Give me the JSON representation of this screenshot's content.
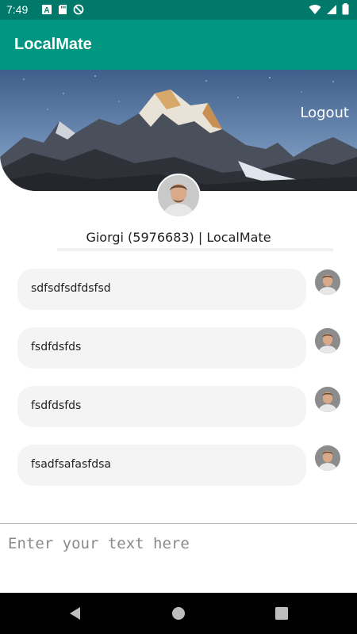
{
  "status_bar": {
    "time": "7:49",
    "left_icons": [
      "a-box-icon",
      "sd-card-icon",
      "no-sync-icon"
    ],
    "right_icons": [
      "wifi-icon",
      "signal-icon",
      "battery-icon"
    ]
  },
  "app_bar": {
    "title": "LocalMate"
  },
  "header": {
    "logout_label": "Logout"
  },
  "user": {
    "info": "Giorgi (5976683) | LocalMate"
  },
  "messages": [
    {
      "text": "sdfsdfsdfdsfsd"
    },
    {
      "text": "fsdfdsfds"
    },
    {
      "text": "fsdfdsfds"
    },
    {
      "text": "fsadfsafasfdsa"
    }
  ],
  "composer": {
    "placeholder": "Enter your text here",
    "value": ""
  },
  "nav_bar": {
    "buttons": [
      "back-icon",
      "home-icon",
      "recents-icon"
    ]
  },
  "colors": {
    "status_bar": "#00796b",
    "app_bar": "#009682",
    "message_bubble": "#f4f4f4"
  }
}
